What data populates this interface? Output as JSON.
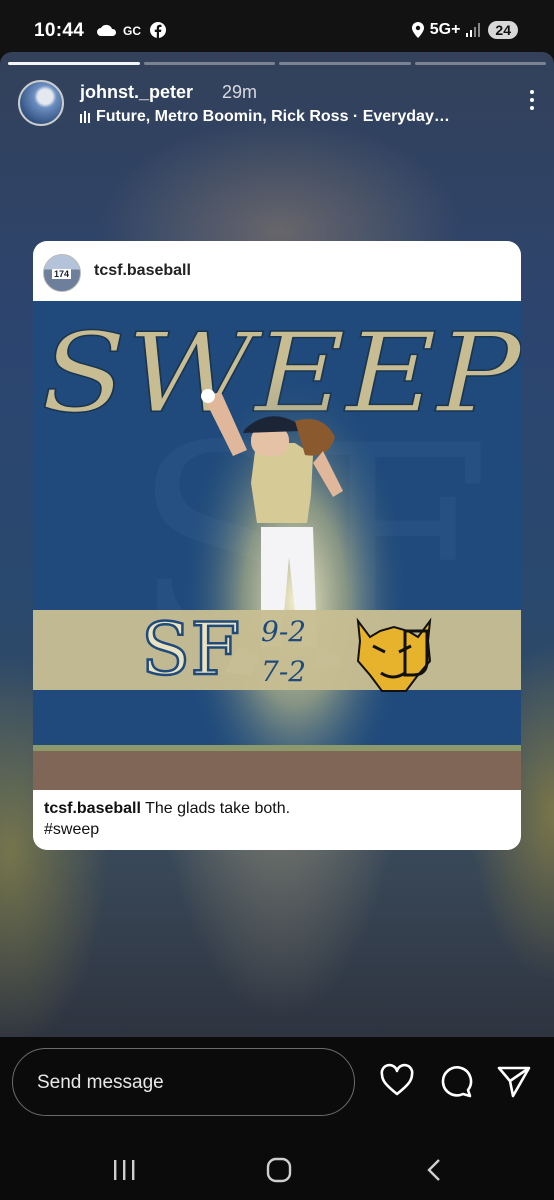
{
  "status_bar": {
    "time": "10:44",
    "network": "5G+",
    "battery": "24"
  },
  "story": {
    "progress_total": 4,
    "progress_done": 1,
    "username": "johnst._peter",
    "posted_ago": "29m",
    "music": "Future, Metro Boomin, Rick Ross · Everyday…"
  },
  "post": {
    "account": "tcsf.baseball",
    "avatar_badge": "174",
    "headline": "SWEEP",
    "team_logo_text": "SF",
    "score_game1": "9-2",
    "score_game2": "7-2",
    "caption_user": "tcsf.baseball",
    "caption_text": "The glads take both.",
    "caption_tag": "#sweep",
    "accent_gold": "#c8bd92",
    "accent_blue": "#1f4a7b"
  },
  "reply": {
    "placeholder": "Send message"
  },
  "icons": {
    "like": "heart-icon",
    "comment": "comment-icon",
    "share": "send-icon"
  },
  "nav": {
    "recents": "recents-icon",
    "home": "home-icon",
    "back": "back-icon"
  }
}
